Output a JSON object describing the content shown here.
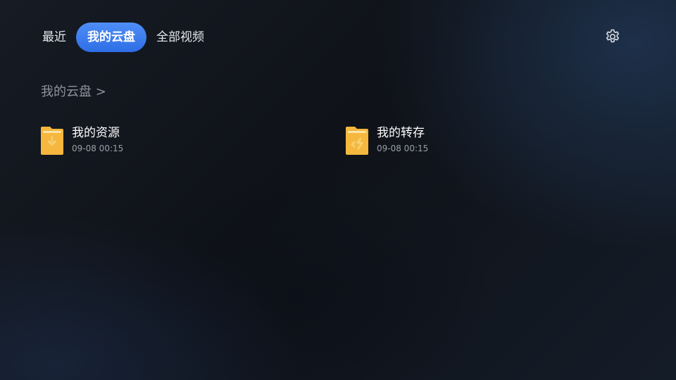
{
  "tabs": [
    {
      "label": "最近",
      "active": false
    },
    {
      "label": "我的云盘",
      "active": true
    },
    {
      "label": "全部视频",
      "active": false
    }
  ],
  "settings": {
    "icon": "gear-icon"
  },
  "breadcrumb": {
    "label": "我的云盘 >"
  },
  "folders": [
    {
      "name": "我的资源",
      "date": "09-08 00:15",
      "icon": "folder-download-icon"
    },
    {
      "name": "我的转存",
      "date": "09-08 00:15",
      "icon": "folder-transfer-icon"
    }
  ],
  "colors": {
    "accent": "#3a7bf0",
    "folder": "#f5b73d",
    "folder_tab": "#fbd88a",
    "muted_text": "#8e939c",
    "background": "#12161e"
  }
}
